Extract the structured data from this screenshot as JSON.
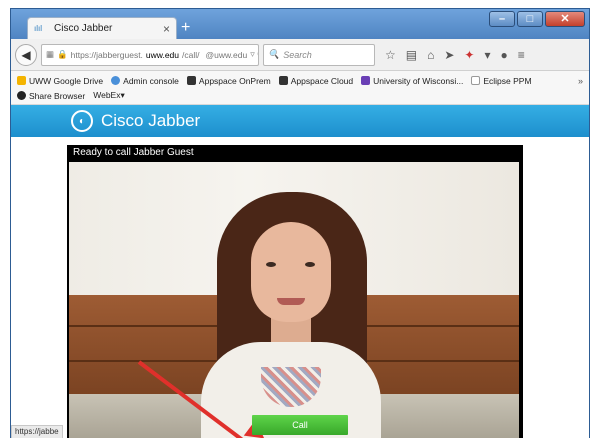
{
  "browser": {
    "tab_title": "Cisco Jabber",
    "url_prefix": "https://jabberguest.",
    "url_host": "uww.edu",
    "url_path": "/call/",
    "url_suffix": "@uww.edu",
    "search_placeholder": "Search",
    "status_text": "https://jabbe"
  },
  "bookmarks": {
    "row1": [
      {
        "label": "UWW Google Drive",
        "color": "#f4b400"
      },
      {
        "label": "Admin console",
        "color": "#4a90d9"
      },
      {
        "label": "Appspace OnPrem",
        "color": "#333333"
      },
      {
        "label": "Appspace Cloud",
        "color": "#333333"
      },
      {
        "label": "University of Wisconsi...",
        "color": "#6a3fb5"
      },
      {
        "label": "Eclipse PPM",
        "color": "#cfcfcf"
      }
    ],
    "row2": [
      {
        "label": "Share Browser",
        "color": "#222222"
      },
      {
        "label": "WebEx▾",
        "color": ""
      }
    ],
    "more": "»"
  },
  "app": {
    "title": "Cisco Jabber",
    "status": "Ready to call Jabber Guest",
    "call_label": "Call"
  },
  "colors": {
    "header_blue": "#1d8fcd",
    "call_green": "#38a82a",
    "arrow_red": "#e0302b"
  }
}
